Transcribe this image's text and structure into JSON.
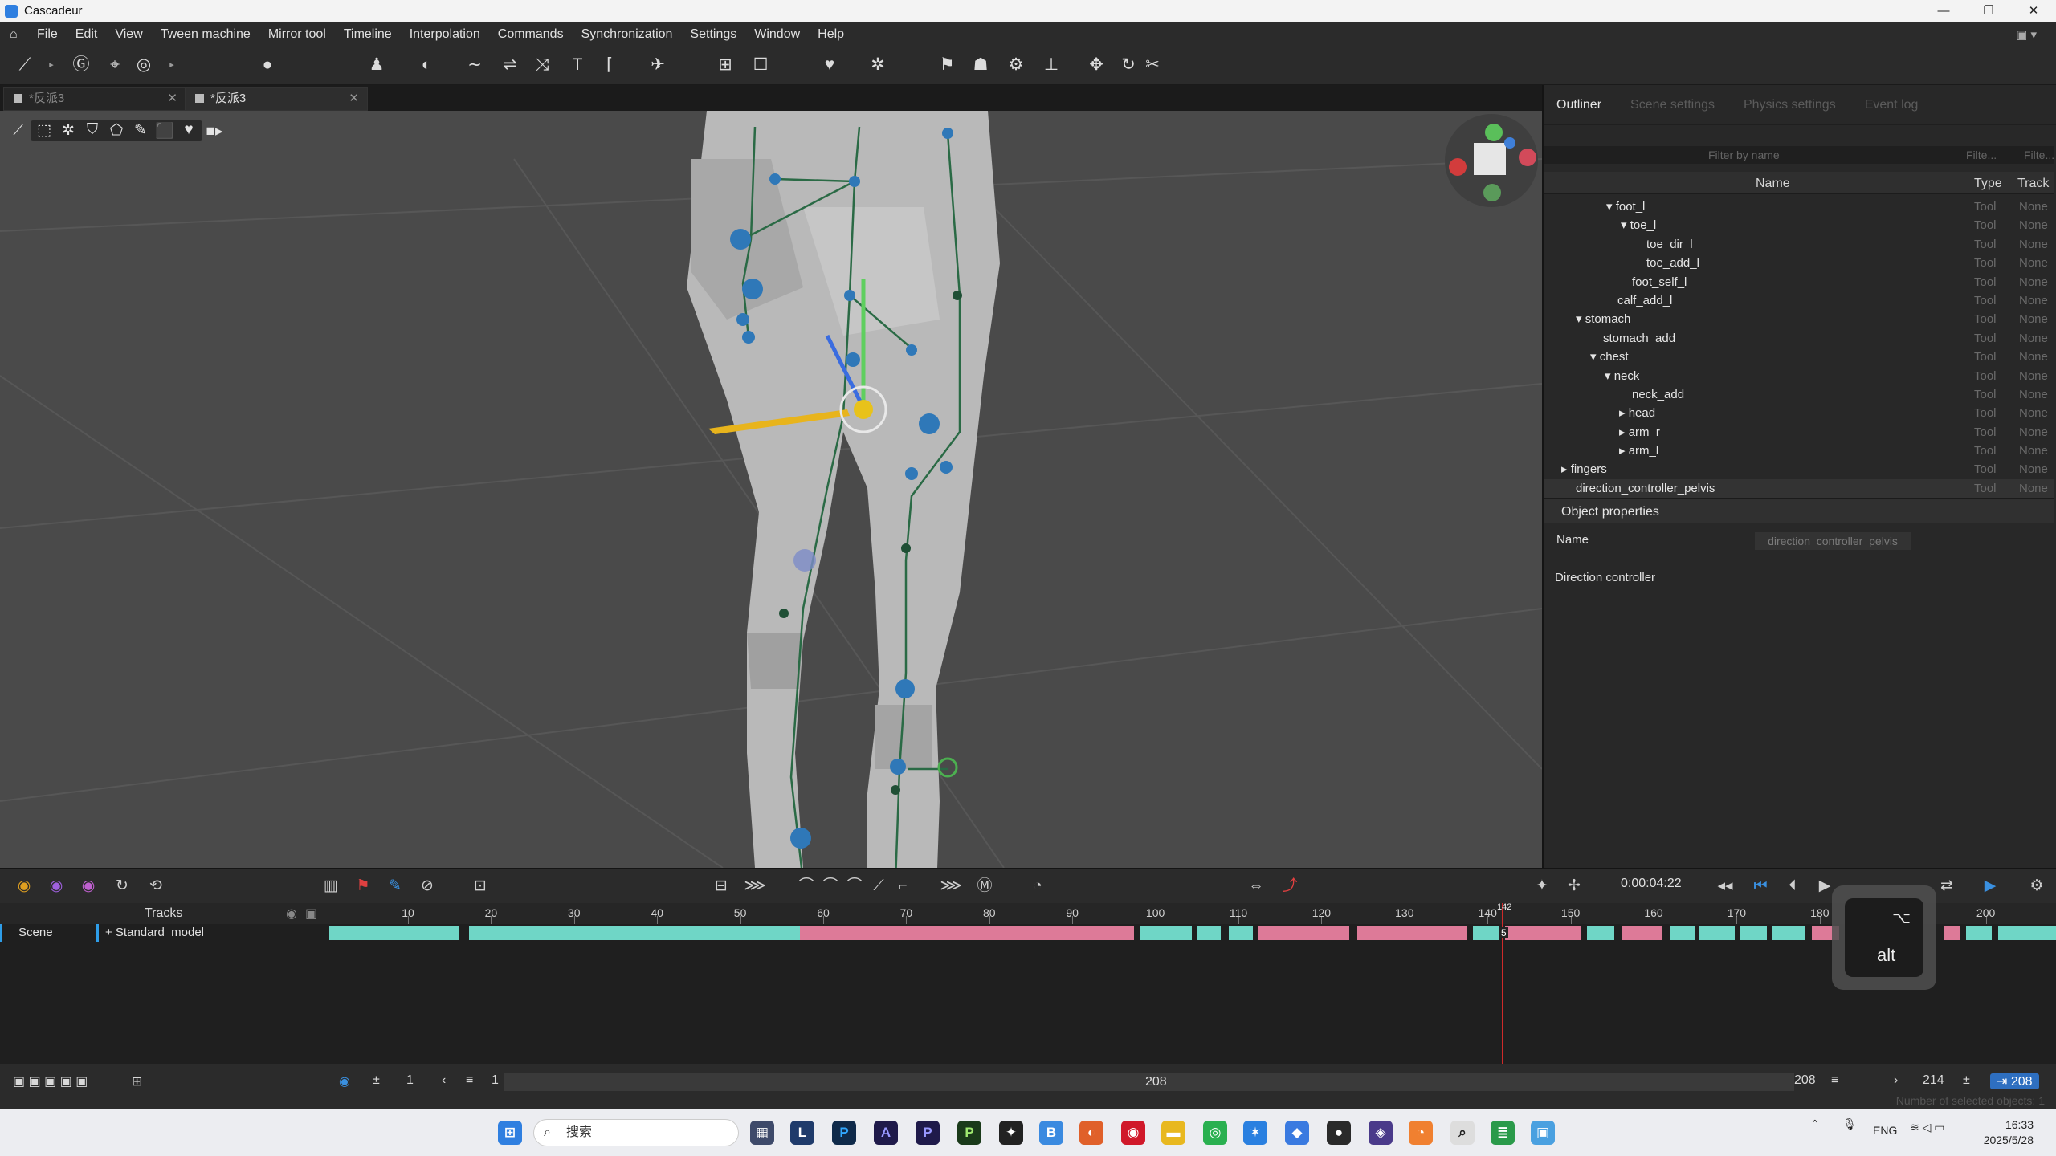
{
  "window": {
    "title": "Cascadeur",
    "controls": [
      "—",
      "❐",
      "✕"
    ]
  },
  "menu": [
    "File",
    "Edit",
    "View",
    "Tween machine",
    "Mirror tool",
    "Timeline",
    "Interpolation",
    "Commands",
    "Synchronization",
    "Settings",
    "Window",
    "Help"
  ],
  "doc_tabs": [
    {
      "label": "*反派3",
      "active": false
    },
    {
      "label": "*反派3",
      "active": true
    }
  ],
  "panel_tabs": [
    {
      "label": "Outliner",
      "active": true
    },
    {
      "label": "Scene settings",
      "active": false
    },
    {
      "label": "Physics settings",
      "active": false
    },
    {
      "label": "Event log",
      "active": false
    }
  ],
  "outliner": {
    "filter_placeholder": "Filter by name",
    "filter_short_1": "Filte...",
    "filter_short_2": "Filte...",
    "col_name": "Name",
    "col_type": "Type",
    "col_track": "Track",
    "rows": [
      {
        "label": "▾ foot_l",
        "type": "Tool",
        "track": "None"
      },
      {
        "label": "▾ toe_l",
        "type": "Tool",
        "track": "None"
      },
      {
        "label": "toe_dir_l",
        "type": "Tool",
        "track": "None"
      },
      {
        "label": "toe_add_l",
        "type": "Tool",
        "track": "None"
      },
      {
        "label": "foot_self_l",
        "type": "Tool",
        "track": "None"
      },
      {
        "label": "calf_add_l",
        "type": "Tool",
        "track": "None"
      },
      {
        "label": "▾ stomach",
        "type": "Tool",
        "track": "None"
      },
      {
        "label": "stomach_add",
        "type": "Tool",
        "track": "None"
      },
      {
        "label": "▾ chest",
        "type": "Tool",
        "track": "None"
      },
      {
        "label": "▾ neck",
        "type": "Tool",
        "track": "None"
      },
      {
        "label": "neck_add",
        "type": "Tool",
        "track": "None"
      },
      {
        "label": "▸ head",
        "type": "Tool",
        "track": "None"
      },
      {
        "label": "▸ arm_r",
        "type": "Tool",
        "track": "None"
      },
      {
        "label": "▸ arm_l",
        "type": "Tool",
        "track": "None"
      },
      {
        "label": "▸ fingers",
        "type": "Tool",
        "track": "None"
      },
      {
        "label": "direction_controller_pelvis",
        "type": "Tool",
        "track": "None"
      }
    ]
  },
  "props": {
    "header": "Object properties",
    "name_label": "Name",
    "name_value": "direction_controller_pelvis",
    "section": "Direction controller"
  },
  "timeline": {
    "time": "0:00:04:22",
    "tracks_header": "Tracks",
    "scene_label": "Scene",
    "model_label": "+ Standard_model",
    "ruler_labels": [
      "10",
      "20",
      "30",
      "40",
      "50",
      "60",
      "70",
      "80",
      "90",
      "100",
      "110",
      "120",
      "130",
      "140",
      "150",
      "160",
      "170",
      "180",
      "190",
      "200"
    ],
    "playhead_frame": "142",
    "key_marker": "5"
  },
  "footer": {
    "start": "1",
    "current": "1",
    "middle": "208",
    "end": "208",
    "total": "214",
    "end_badge": "208",
    "selected": "Number of selected objects: 1"
  },
  "key_overlay": {
    "symbol": "⌥",
    "label": "alt"
  },
  "taskbar": {
    "search": "搜索",
    "tray_lang": "ENG",
    "time": "16:33",
    "date": "2025/5/28"
  },
  "colors": {
    "teal": "#6fd6c6",
    "pink": "#dd7a98",
    "blue": "#2e9de8",
    "accent_red": "#cf2a2a"
  }
}
